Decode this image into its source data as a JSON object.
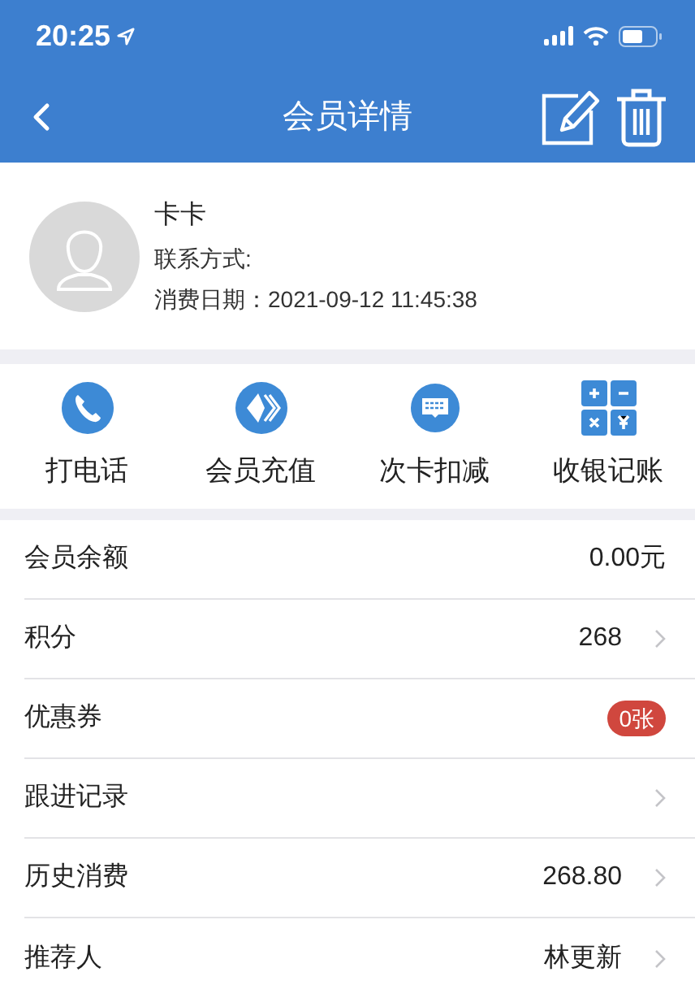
{
  "status_bar": {
    "time": "20:25"
  },
  "nav": {
    "title": "会员详情"
  },
  "profile": {
    "name": "卡卡",
    "contact": "联系方式:",
    "date": "消费日期：2021-09-12 11:45:38"
  },
  "actions": [
    {
      "kind": "phone",
      "label": "打电话"
    },
    {
      "kind": "recharge",
      "label": "会员充值"
    },
    {
      "kind": "card",
      "label": "次卡扣减"
    },
    {
      "kind": "calculator",
      "label": "收银记账"
    }
  ],
  "rows": [
    {
      "kind": "text",
      "label": "会员余额",
      "value": "0.00元",
      "chevron": false
    },
    {
      "kind": "text",
      "label": "积分",
      "value": "268",
      "chevron": true
    },
    {
      "kind": "badge",
      "label": "优惠券",
      "value": "0张",
      "chevron": false
    },
    {
      "kind": "text",
      "label": "跟进记录",
      "chevron": true
    },
    {
      "kind": "text",
      "label": "历史消费",
      "value": "268.80",
      "chevron": true
    },
    {
      "kind": "text",
      "label": "推荐人",
      "value": "林更新",
      "chevron": true
    }
  ]
}
